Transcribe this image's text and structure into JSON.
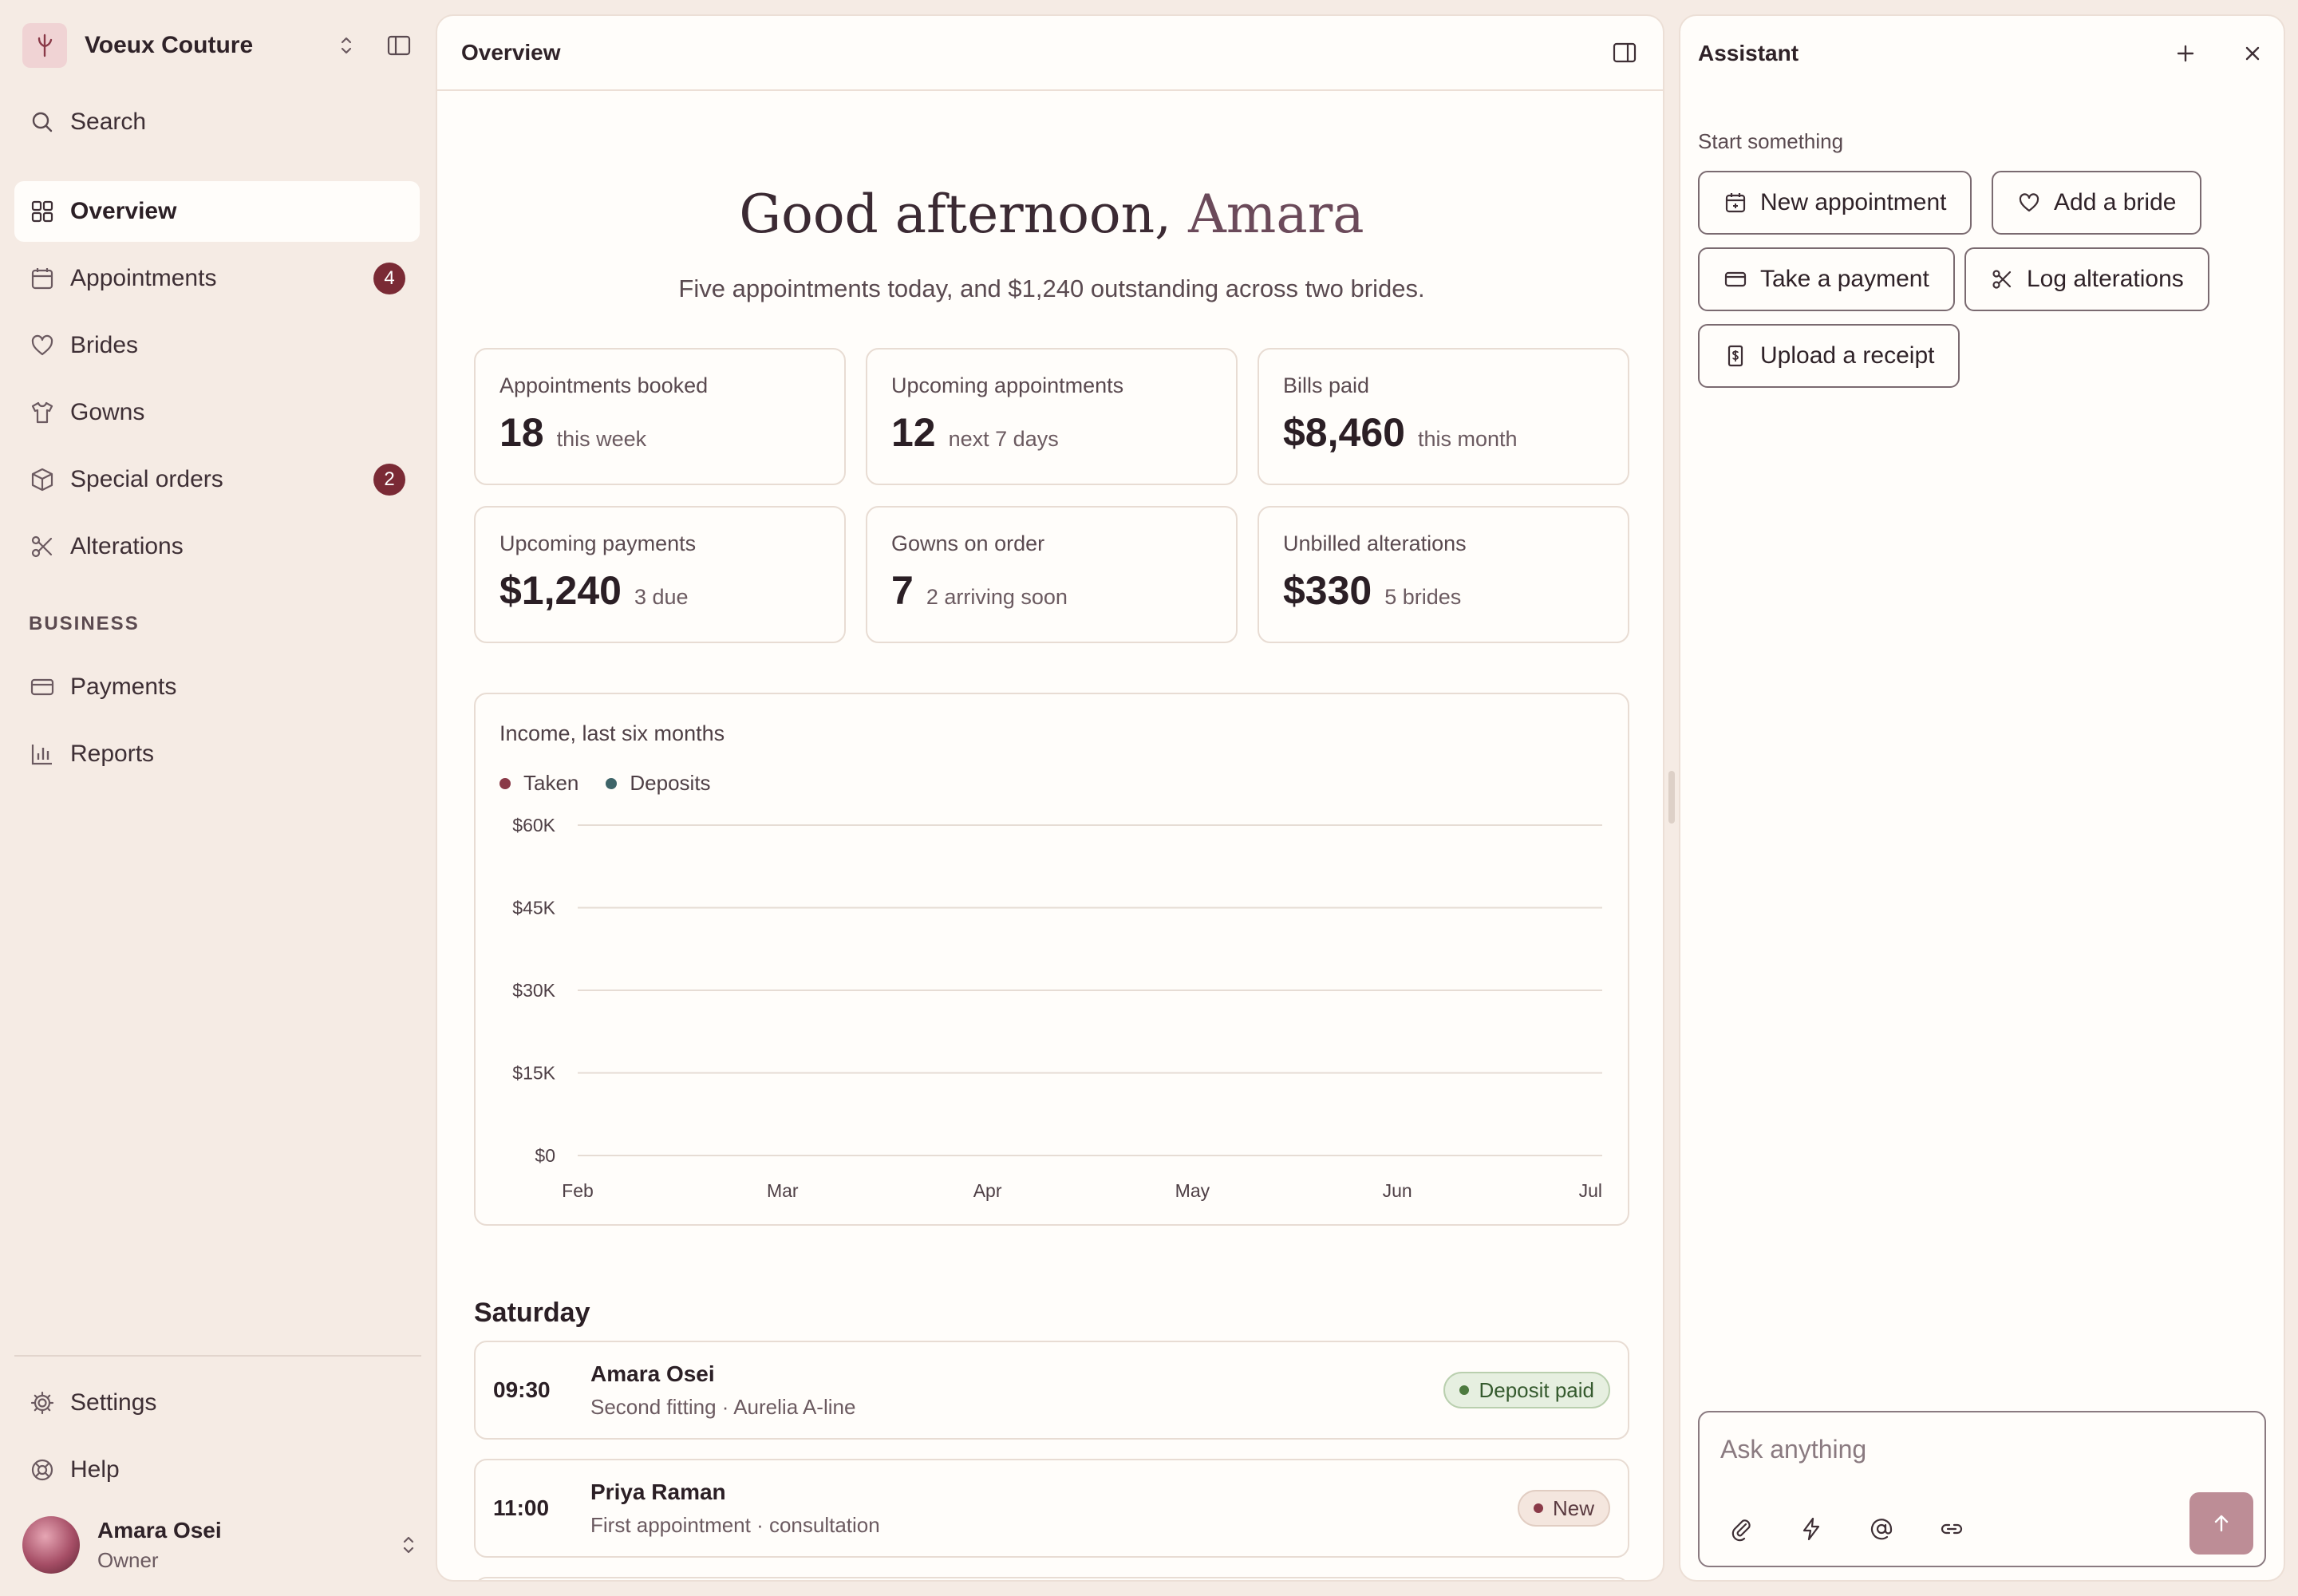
{
  "sidebar": {
    "brand": "Voeux Couture",
    "search_label": "Search",
    "items": [
      {
        "label": "Overview",
        "active": true
      },
      {
        "label": "Appointments",
        "badge": "4"
      },
      {
        "label": "Brides"
      },
      {
        "label": "Gowns"
      },
      {
        "label": "Special orders",
        "badge": "2"
      },
      {
        "label": "Alterations"
      }
    ],
    "business_label": "BUSINESS",
    "business_items": [
      {
        "label": "Payments"
      },
      {
        "label": "Reports"
      }
    ],
    "footer_items": [
      {
        "label": "Settings"
      },
      {
        "label": "Help"
      }
    ],
    "user": {
      "name": "Amara Osei",
      "role": "Owner"
    }
  },
  "main": {
    "title": "Overview",
    "greeting_prefix": "Good afternoon, ",
    "greeting_name": "Amara",
    "subtitle": "Five appointments today, and $1,240 outstanding across two brides.",
    "stats": [
      {
        "label": "Appointments booked",
        "value": "18",
        "note": "this week"
      },
      {
        "label": "Upcoming appointments",
        "value": "12",
        "note": "next 7 days"
      },
      {
        "label": "Bills paid",
        "value": "$8,460",
        "note": "this month"
      },
      {
        "label": "Upcoming payments",
        "value": "$1,240",
        "note": "3 due"
      },
      {
        "label": "Gowns on order",
        "value": "7",
        "note": "2 arriving soon"
      },
      {
        "label": "Unbilled alterations",
        "value": "$330",
        "note": "5 brides"
      }
    ],
    "day_title": "Saturday",
    "appointments": [
      {
        "time": "09:30",
        "name": "Amara Osei",
        "detail": "Second fitting · Aurelia A-line",
        "status": "Deposit paid"
      },
      {
        "time": "11:00",
        "name": "Priya Raman",
        "detail": "First appointment · consultation",
        "status": "New"
      }
    ]
  },
  "chart_data": {
    "type": "line",
    "title": "Income, last six months",
    "categories": [
      "Feb",
      "Mar",
      "Apr",
      "May",
      "Jun",
      "Jul"
    ],
    "series": [
      {
        "name": "Taken",
        "color": "#8a3a48",
        "values": []
      },
      {
        "name": "Deposits",
        "color": "#3e6468",
        "values": []
      }
    ],
    "y_ticks": [
      "$0",
      "$15K",
      "$30K",
      "$45K",
      "$60K"
    ],
    "ylim": [
      0,
      60000
    ],
    "grid": true,
    "legend": "top-left"
  },
  "assistant": {
    "title": "Assistant",
    "section_label": "Start something",
    "actions": [
      {
        "label": "New appointment",
        "icon": "calendar-plus-icon"
      },
      {
        "label": "Add a bride",
        "icon": "heart-icon"
      },
      {
        "label": "Take a payment",
        "icon": "card-icon"
      },
      {
        "label": "Log alterations",
        "icon": "scissors-icon"
      },
      {
        "label": "Upload a receipt",
        "icon": "receipt-icon"
      }
    ],
    "composer_placeholder": "Ask anything"
  },
  "colors": {
    "accent": "#7a2a35",
    "background": "#f5ebe4",
    "panel": "#fffdfa",
    "status_green": "#4d7a3f",
    "send_button": "#bd8d96"
  }
}
